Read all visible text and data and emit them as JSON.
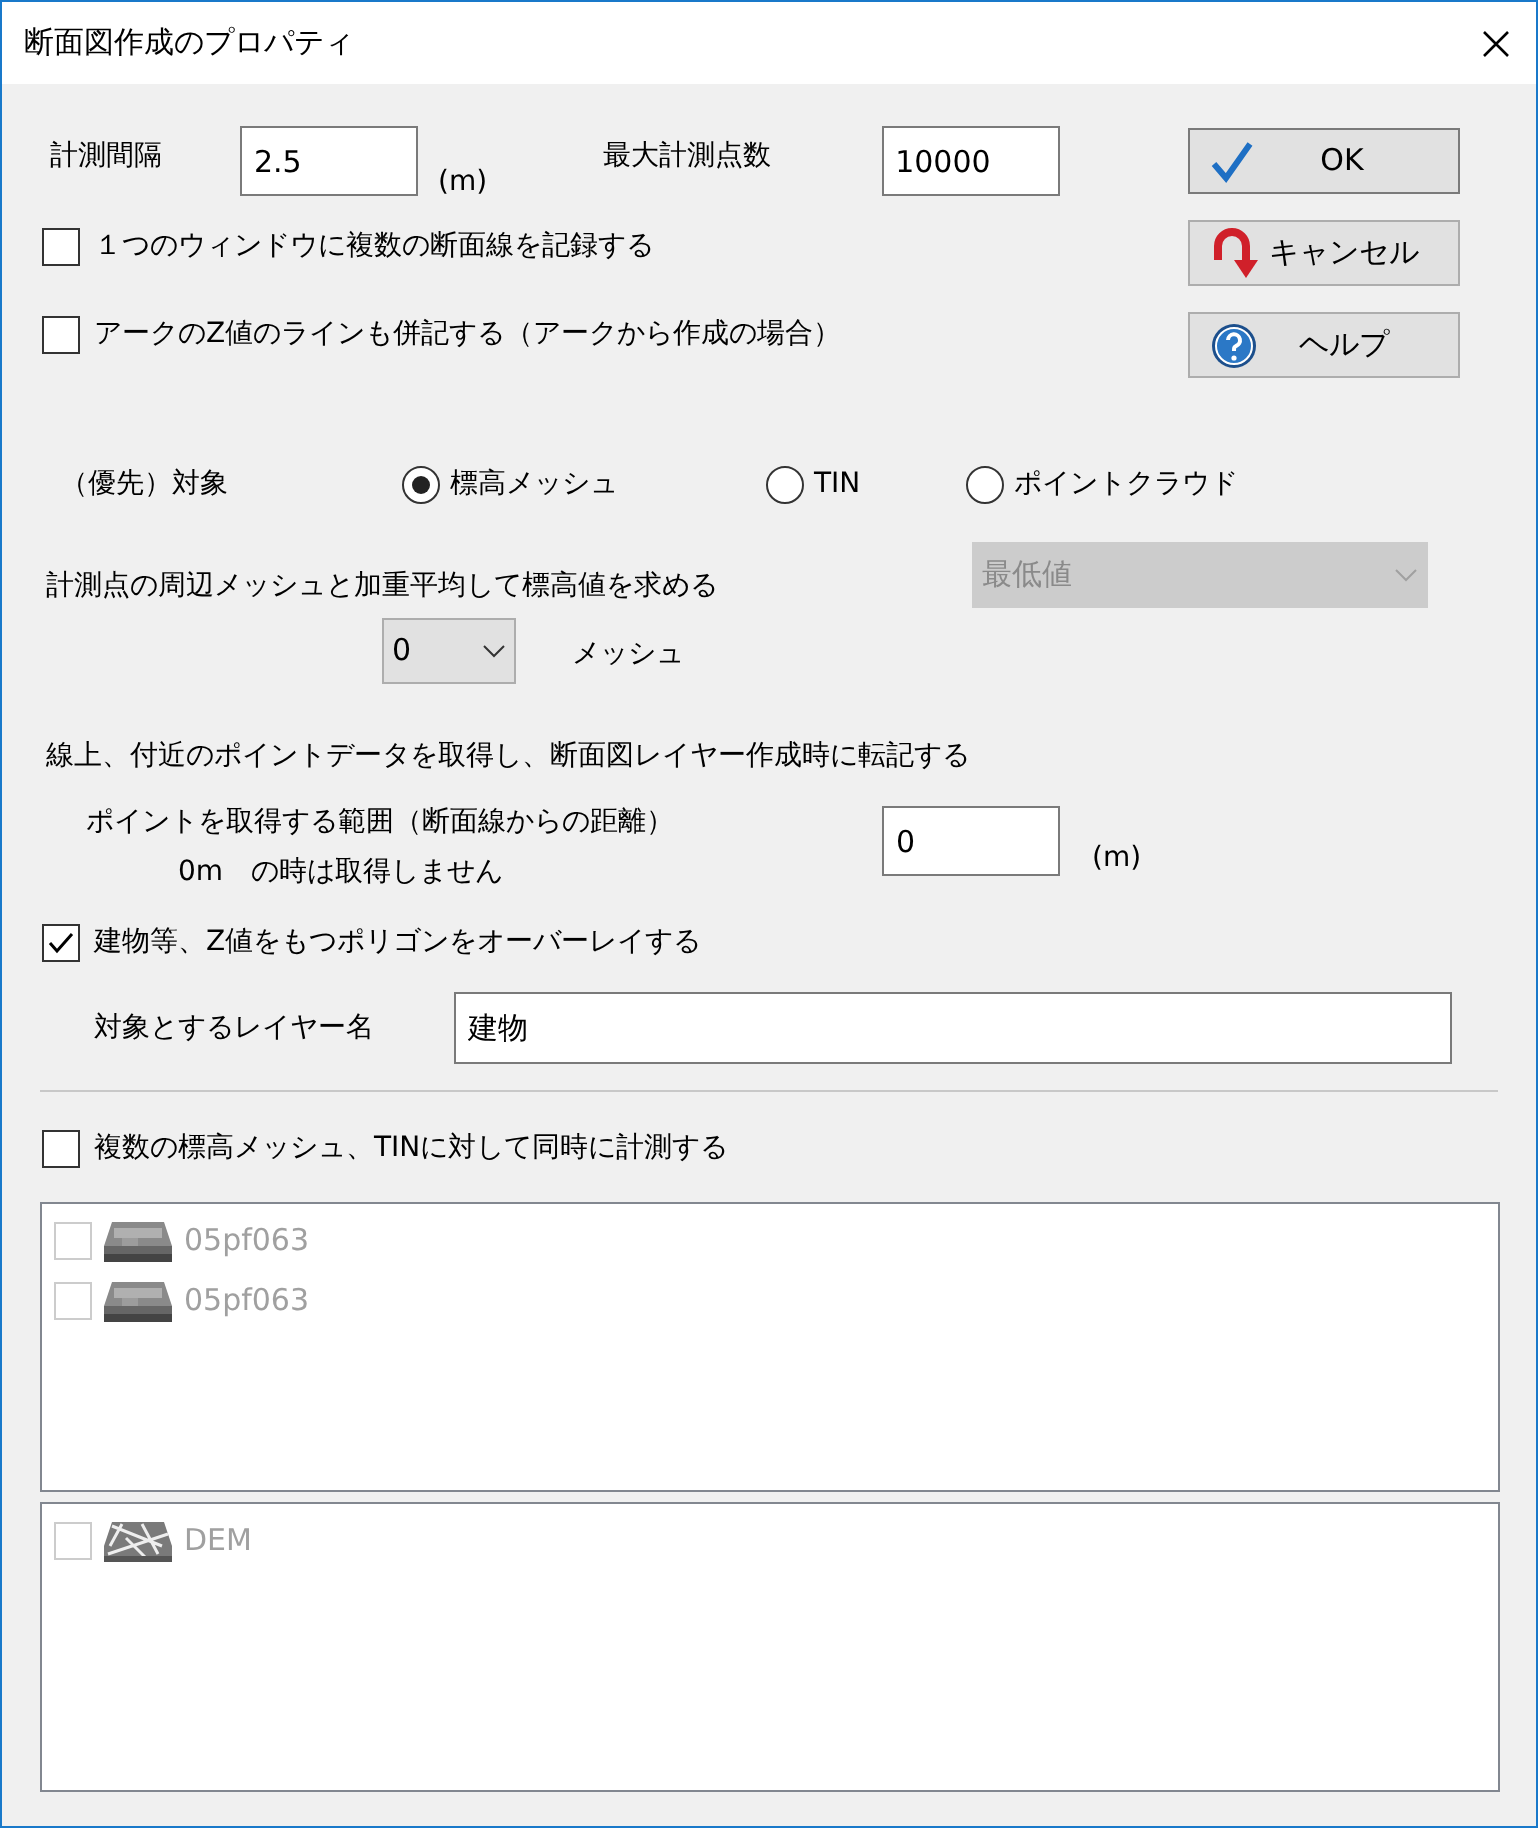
{
  "window": {
    "title": "断面図作成のプロパティ"
  },
  "interval": {
    "label": "計測間隔",
    "value": "2.5",
    "unit": "(m)"
  },
  "max_points": {
    "label": "最大計測点数",
    "value": "10000"
  },
  "buttons": [
    {
      "label": "OK",
      "kind": "ok"
    },
    {
      "label": "キャンセル",
      "kind": "cancel"
    },
    {
      "label": "ヘルプ",
      "kind": "help"
    }
  ],
  "options": [
    {
      "label": "１つのウィンドウに複数の断面線を記録する",
      "checked": false
    },
    {
      "label": "アークのZ値のラインも併記する（アークから作成の場合）",
      "checked": false
    }
  ],
  "target": {
    "label": "（優先）対象",
    "radios": [
      {
        "label": "標高メッシュ",
        "selected": true
      },
      {
        "label": "TIN",
        "selected": false
      },
      {
        "label": "ポイントクラウド",
        "selected": false
      }
    ]
  },
  "weighted": {
    "label": "計測点の周辺メッシュと加重平均して標高値を求める",
    "method": {
      "value": "最低値",
      "disabled": true
    },
    "count": {
      "value": "0"
    },
    "unit": "メッシュ"
  },
  "points": {
    "label": "線上、付近のポイントデータを取得し、断面図レイヤー作成時に転記する",
    "range_label": "ポイントを取得する範囲（断面線からの距離）",
    "range_note": "0m　の時は取得しません",
    "value": "0",
    "unit": "(m)"
  },
  "overlay": {
    "label": "建物等、Z値をもつポリゴンをオーバーレイする",
    "checked": true,
    "layer_label": "対象とするレイヤー名",
    "layer_value": "建物"
  },
  "multi": {
    "label": "複数の標高メッシュ、TINに対して同時に計測する",
    "checked": false
  },
  "lists": [
    {
      "items": [
        {
          "label": "05pf063",
          "kind": "mesh",
          "checked": false,
          "disabled": true
        },
        {
          "label": "05pf063",
          "kind": "mesh",
          "checked": false,
          "disabled": true
        }
      ]
    },
    {
      "items": [
        {
          "label": "DEM",
          "kind": "tin",
          "checked": false,
          "disabled": true
        }
      ]
    }
  ]
}
